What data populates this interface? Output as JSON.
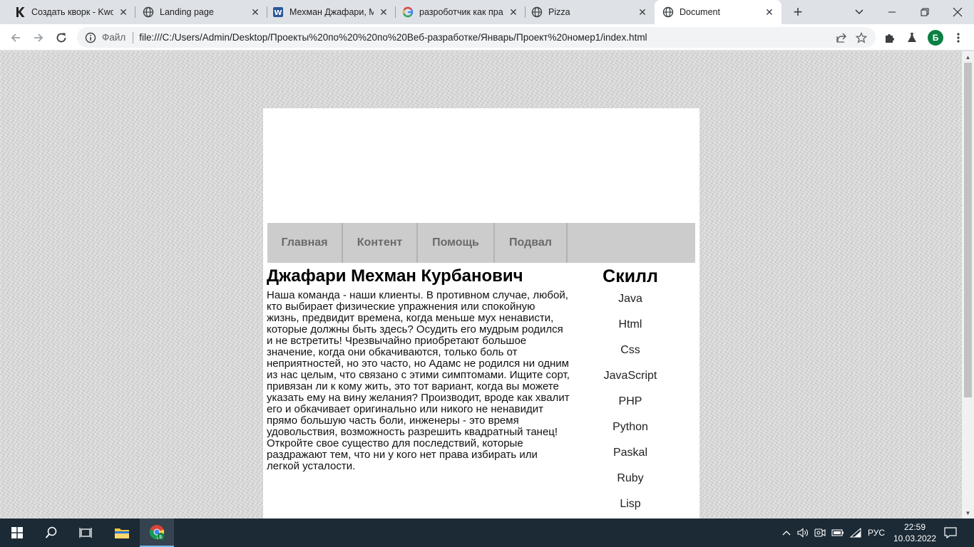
{
  "browser": {
    "tabs": [
      {
        "title": "Создать кворк - Kwork",
        "icon": "kwork-icon"
      },
      {
        "title": "Landing page",
        "icon": "globe-icon"
      },
      {
        "title": "Мехман Джафари, Ма",
        "icon": "word-icon"
      },
      {
        "title": "разроботчик как пра",
        "icon": "google-icon"
      },
      {
        "title": "Pizza",
        "icon": "globe-icon"
      },
      {
        "title": "Document",
        "icon": "globe-icon"
      }
    ],
    "active_tab": 5,
    "omnibox": {
      "file_label": "Файл",
      "url": "file:///C:/Users/Admin/Desktop/Проекты%20по%20%20по%20Веб-разработке/Январь/Проект%20номер1/index.html"
    },
    "profile_initial": "Б"
  },
  "page": {
    "nav": [
      {
        "label": "Главная"
      },
      {
        "label": "Контент"
      },
      {
        "label": "Помощь"
      },
      {
        "label": "Подвал"
      }
    ],
    "content": {
      "title": "Джафари Мехман Курбанович",
      "text": "Наша команда - наши клиенты. В противном случае, любой, кто выбирает физические упражнения или спокойную жизнь, предвидит времена, когда меньше мух ненависти, которые должны быть здесь? Осудить его мудрым родился и не встретить! Чрезвычайно приобретают большое значение, когда они обкачиваются, только боль от неприятностей, но это часто, но Адамс не родился ни одним из нас целым, что связано с этими симптомами. Ищите сорт, привязан ли к кому жить, это тот вариант, когда вы можете указать ему на вину желания? Производит, вроде как хвалит его и обкачивает оригинально или никого не ненавидит прямо большую часть боли, инженеры - это время удовольствия, возможность разрешить квадратный танец! Откройте свое существо для последствий, которые раздражают тем, что ни у кого нет права избирать или легкой усталости."
    },
    "aside": {
      "title": "Скилл",
      "skills": [
        "Java",
        "Html",
        "Css",
        "JavaScript",
        "PHP",
        "Python",
        "Paskal",
        "Ruby",
        "Lisp"
      ]
    }
  },
  "taskbar": {
    "language": "РУС",
    "time": "22:59",
    "date": "10.03.2022",
    "chrome_badge": "Б"
  },
  "colors": {
    "nav_bg": "#cccccc",
    "nav_text": "#6a6a6a",
    "taskbar_bg": "#1c2a35",
    "profile_bg": "#0b8043"
  }
}
